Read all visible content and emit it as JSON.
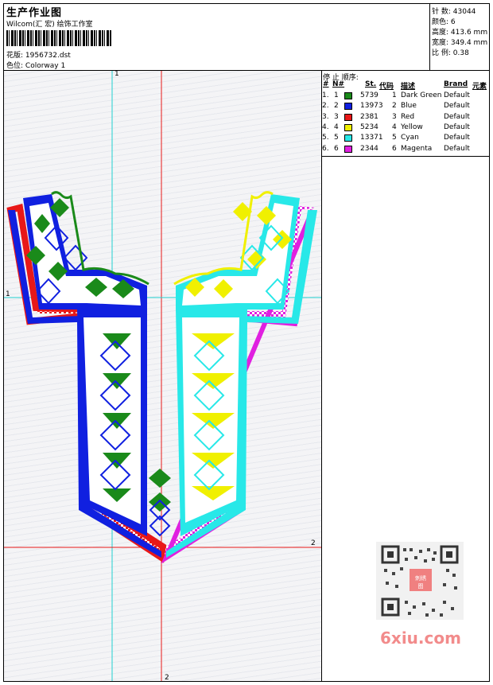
{
  "header": {
    "title": "生产作业图",
    "subtitle": "Wilcom(汇 宏) 绘饰工作室",
    "pattern_label": "花版:",
    "pattern_value": "1956732.dst",
    "color_label": "色位:",
    "color_value": "Colorway 1"
  },
  "stats": {
    "stitches_label": "针 数:",
    "stitches_value": "43044",
    "colors_label": "颜色:",
    "colors_value": "6",
    "height_label": "高度:",
    "height_value": "413.6 mm",
    "width_label": "宽度:",
    "width_value": "349.4 mm",
    "ratio_label": "比 例:",
    "ratio_value": "0.38"
  },
  "color_table": {
    "heading": "停 止 顺序:",
    "columns": [
      "#",
      "N#",
      "St.",
      "代码",
      "描述",
      "Brand",
      "元素"
    ],
    "rows": [
      {
        "idx": "1.",
        "n": "1",
        "st": "5739",
        "code": "1",
        "desc": "Dark Green",
        "brand": "Default",
        "color": "#1a8a1a"
      },
      {
        "idx": "2.",
        "n": "2",
        "st": "13973",
        "code": "2",
        "desc": "Blue",
        "brand": "Default",
        "color": "#1020e0"
      },
      {
        "idx": "3.",
        "n": "3",
        "st": "2381",
        "code": "3",
        "desc": "Red",
        "brand": "Default",
        "color": "#e81818"
      },
      {
        "idx": "4.",
        "n": "4",
        "st": "5234",
        "code": "4",
        "desc": "Yellow",
        "brand": "Default",
        "color": "#f0f000"
      },
      {
        "idx": "5.",
        "n": "5",
        "st": "13371",
        "code": "5",
        "desc": "Cyan",
        "brand": "Default",
        "color": "#28e8e8"
      },
      {
        "idx": "6.",
        "n": "6",
        "st": "2344",
        "code": "6",
        "desc": "Magenta",
        "brand": "Default",
        "color": "#e020e0"
      }
    ]
  },
  "guides": {
    "v1_label": "1",
    "v2_label": "2",
    "h1_label": "1",
    "h2_label": "2"
  },
  "watermark": "6xiu.com",
  "qr_badge": "刺绣图"
}
